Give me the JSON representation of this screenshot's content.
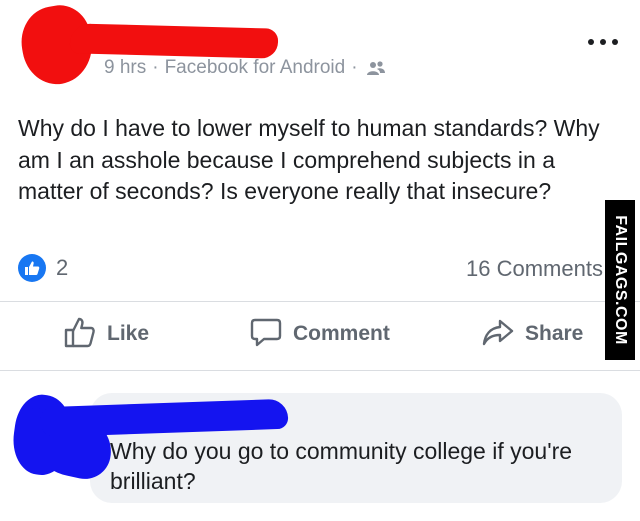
{
  "post": {
    "timestamp": "9 hrs",
    "separator": "·",
    "source": "Facebook for Android",
    "audience_icon": "friends-icon",
    "more_icon": "more-options-icon",
    "body": "Why do I have to lower myself to human standards? Why am I an asshole because I comprehend subjects in a matter of seconds? Is everyone really that insecure?",
    "redaction_color": "#f20f0f"
  },
  "engagement": {
    "reaction_icon": "like-badge-icon",
    "reaction_count": "2",
    "comment_count": "16 Comments"
  },
  "actions": {
    "like_label": "Like",
    "comment_label": "Comment",
    "share_label": "Share"
  },
  "comment": {
    "text": "Why do you go to community college if you're brilliant?",
    "redaction_color": "#1414f0"
  },
  "watermark": {
    "text": "FAILGAGS.COM"
  },
  "colors": {
    "accent": "#1877f2",
    "meta_text": "#8d949e",
    "action_text": "#606770",
    "bubble": "#f0f2f5"
  }
}
